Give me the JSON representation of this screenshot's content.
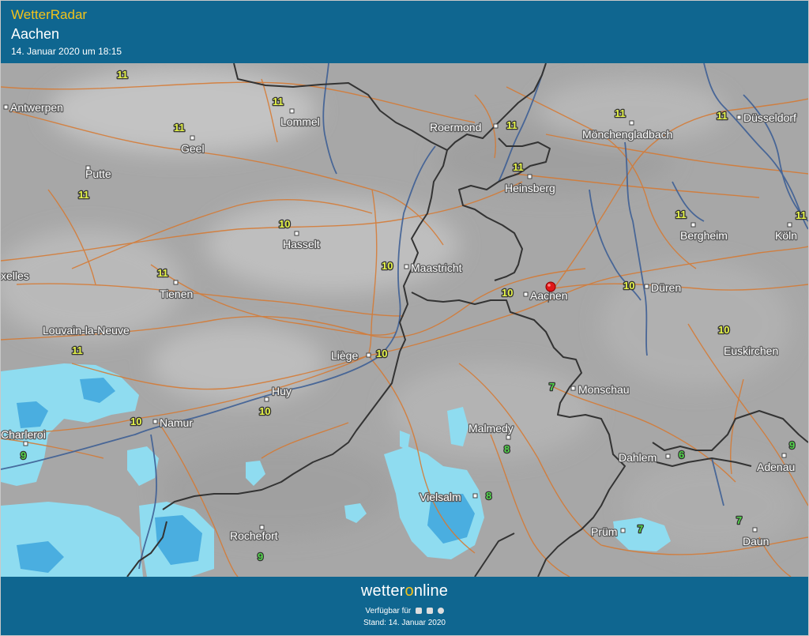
{
  "header": {
    "app_title": "WetterRadar",
    "location": "Aachen",
    "timestamp": "14. Januar 2020 um 18:15"
  },
  "map": {
    "colors": {
      "base": "#a7a7a7",
      "roads": "#d7782f",
      "rivers": "#3e5f95",
      "borders": "#333333",
      "rain_light": "#8fdcf0",
      "rain_medium": "#4aaee0",
      "marker": "#e01818"
    },
    "marker_label": "Aachen",
    "cities": {
      "antwerpen": "Antwerpen",
      "lommel": "Lommel",
      "roermond": "Roermond",
      "moenchengladbach": "Mönchengladbach",
      "duesseldorf": "Düsseldorf",
      "geel": "Geel",
      "putte": "Putte",
      "heinsberg": "Heinsberg",
      "hasselt": "Hasselt",
      "bergheim": "Bergheim",
      "koeln": "Köln",
      "bruxelles": "xelles",
      "maastricht": "Maastricht",
      "tienen": "Tienen",
      "aachen": "Aachen",
      "dueren": "Düren",
      "louvain": "Louvain-la-Neuve",
      "liege": "Liège",
      "euskirchen": "Euskirchen",
      "huy": "Huy",
      "monschau": "Monschau",
      "namur": "Namur",
      "charleroi": "Charleroi",
      "malmedy": "Malmedy",
      "dahlem": "Dahlem",
      "adenau": "Adenau",
      "vielsalm": "Vielsalm",
      "pruem": "Prüm",
      "rochefort": "Rochefort",
      "daun": "Daun"
    },
    "temps": {
      "t_top": "11",
      "t_lommel": "11",
      "t_geel": "11",
      "t_putte": "11",
      "t_roermond": "11",
      "t_mgladbach": "11",
      "t_duesseldorf": "11",
      "t_heinsberg": "11",
      "t_bergheim": "11",
      "t_koeln": "11",
      "t_hasselt": "10",
      "t_maastricht": "10",
      "t_tienen": "11",
      "t_aachen": "10",
      "t_dueren": "10",
      "t_louvain": "11",
      "t_liege": "10",
      "t_euskirchen": "10",
      "t_huy": "10",
      "t_monschau": "7",
      "t_namur": "10",
      "t_charleroi": "9",
      "t_malmedy": "8",
      "t_dahlem": "6",
      "t_adenau": "9",
      "t_vielsalm": "8",
      "t_pruem": "7",
      "t_rochefort": "9",
      "t_daun": "7"
    }
  },
  "footer": {
    "brand_prefix": "wetter",
    "brand_accent": "o",
    "brand_suffix": "nline",
    "available": "Verfügbar für",
    "platform_icons": [
      "android-icon",
      "apple-icon",
      "windows-icon"
    ],
    "stand": "Stand: 14. Januar 2020"
  }
}
